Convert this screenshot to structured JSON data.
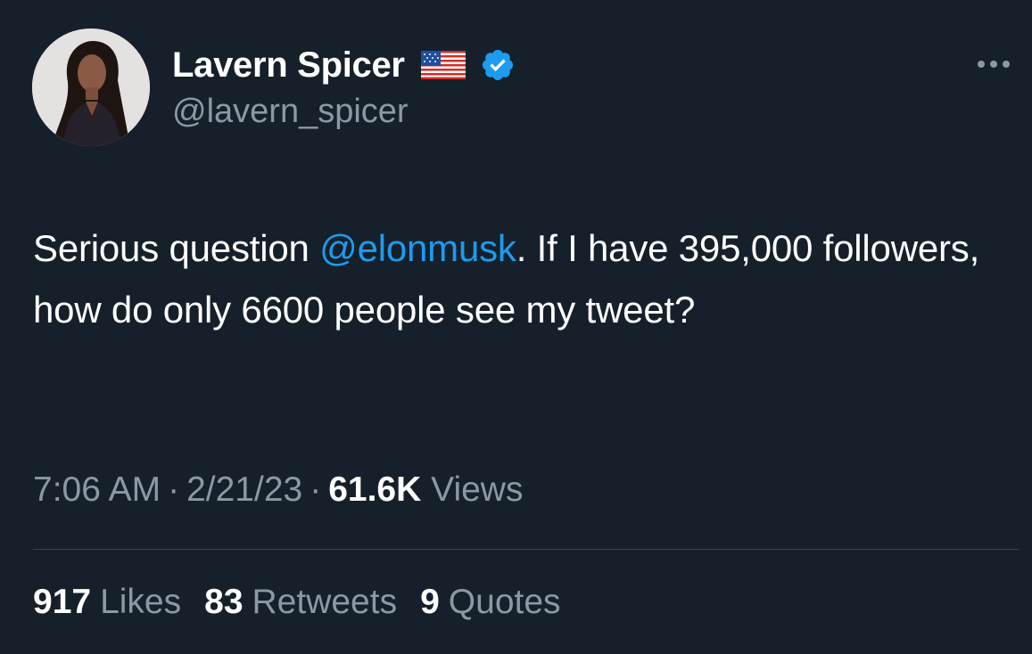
{
  "author": {
    "display_name": "Lavern Spicer",
    "handle": "@lavern_spicer",
    "flag_icon": "us-flag-icon",
    "verified_icon": "verified-badge-icon",
    "verified_color": "#1d9bf0"
  },
  "tweet": {
    "text_before": "Serious question ",
    "mention": "@elonmusk",
    "text_after": ". If I have 395,000 followers, how do only 6600 people see my tweet?"
  },
  "meta": {
    "time": "7:06 AM",
    "separator": "·",
    "date": "2/21/23",
    "views_count": "61.6K",
    "views_label": "Views"
  },
  "stats": {
    "likes_count": "917",
    "likes_label": "Likes",
    "retweets_count": "83",
    "retweets_label": "Retweets",
    "quotes_count": "9",
    "quotes_label": "Quotes"
  },
  "colors": {
    "background": "#15202b",
    "secondary_text": "#8b98a5",
    "link": "#1d9bf0",
    "divider": "#38444d"
  }
}
